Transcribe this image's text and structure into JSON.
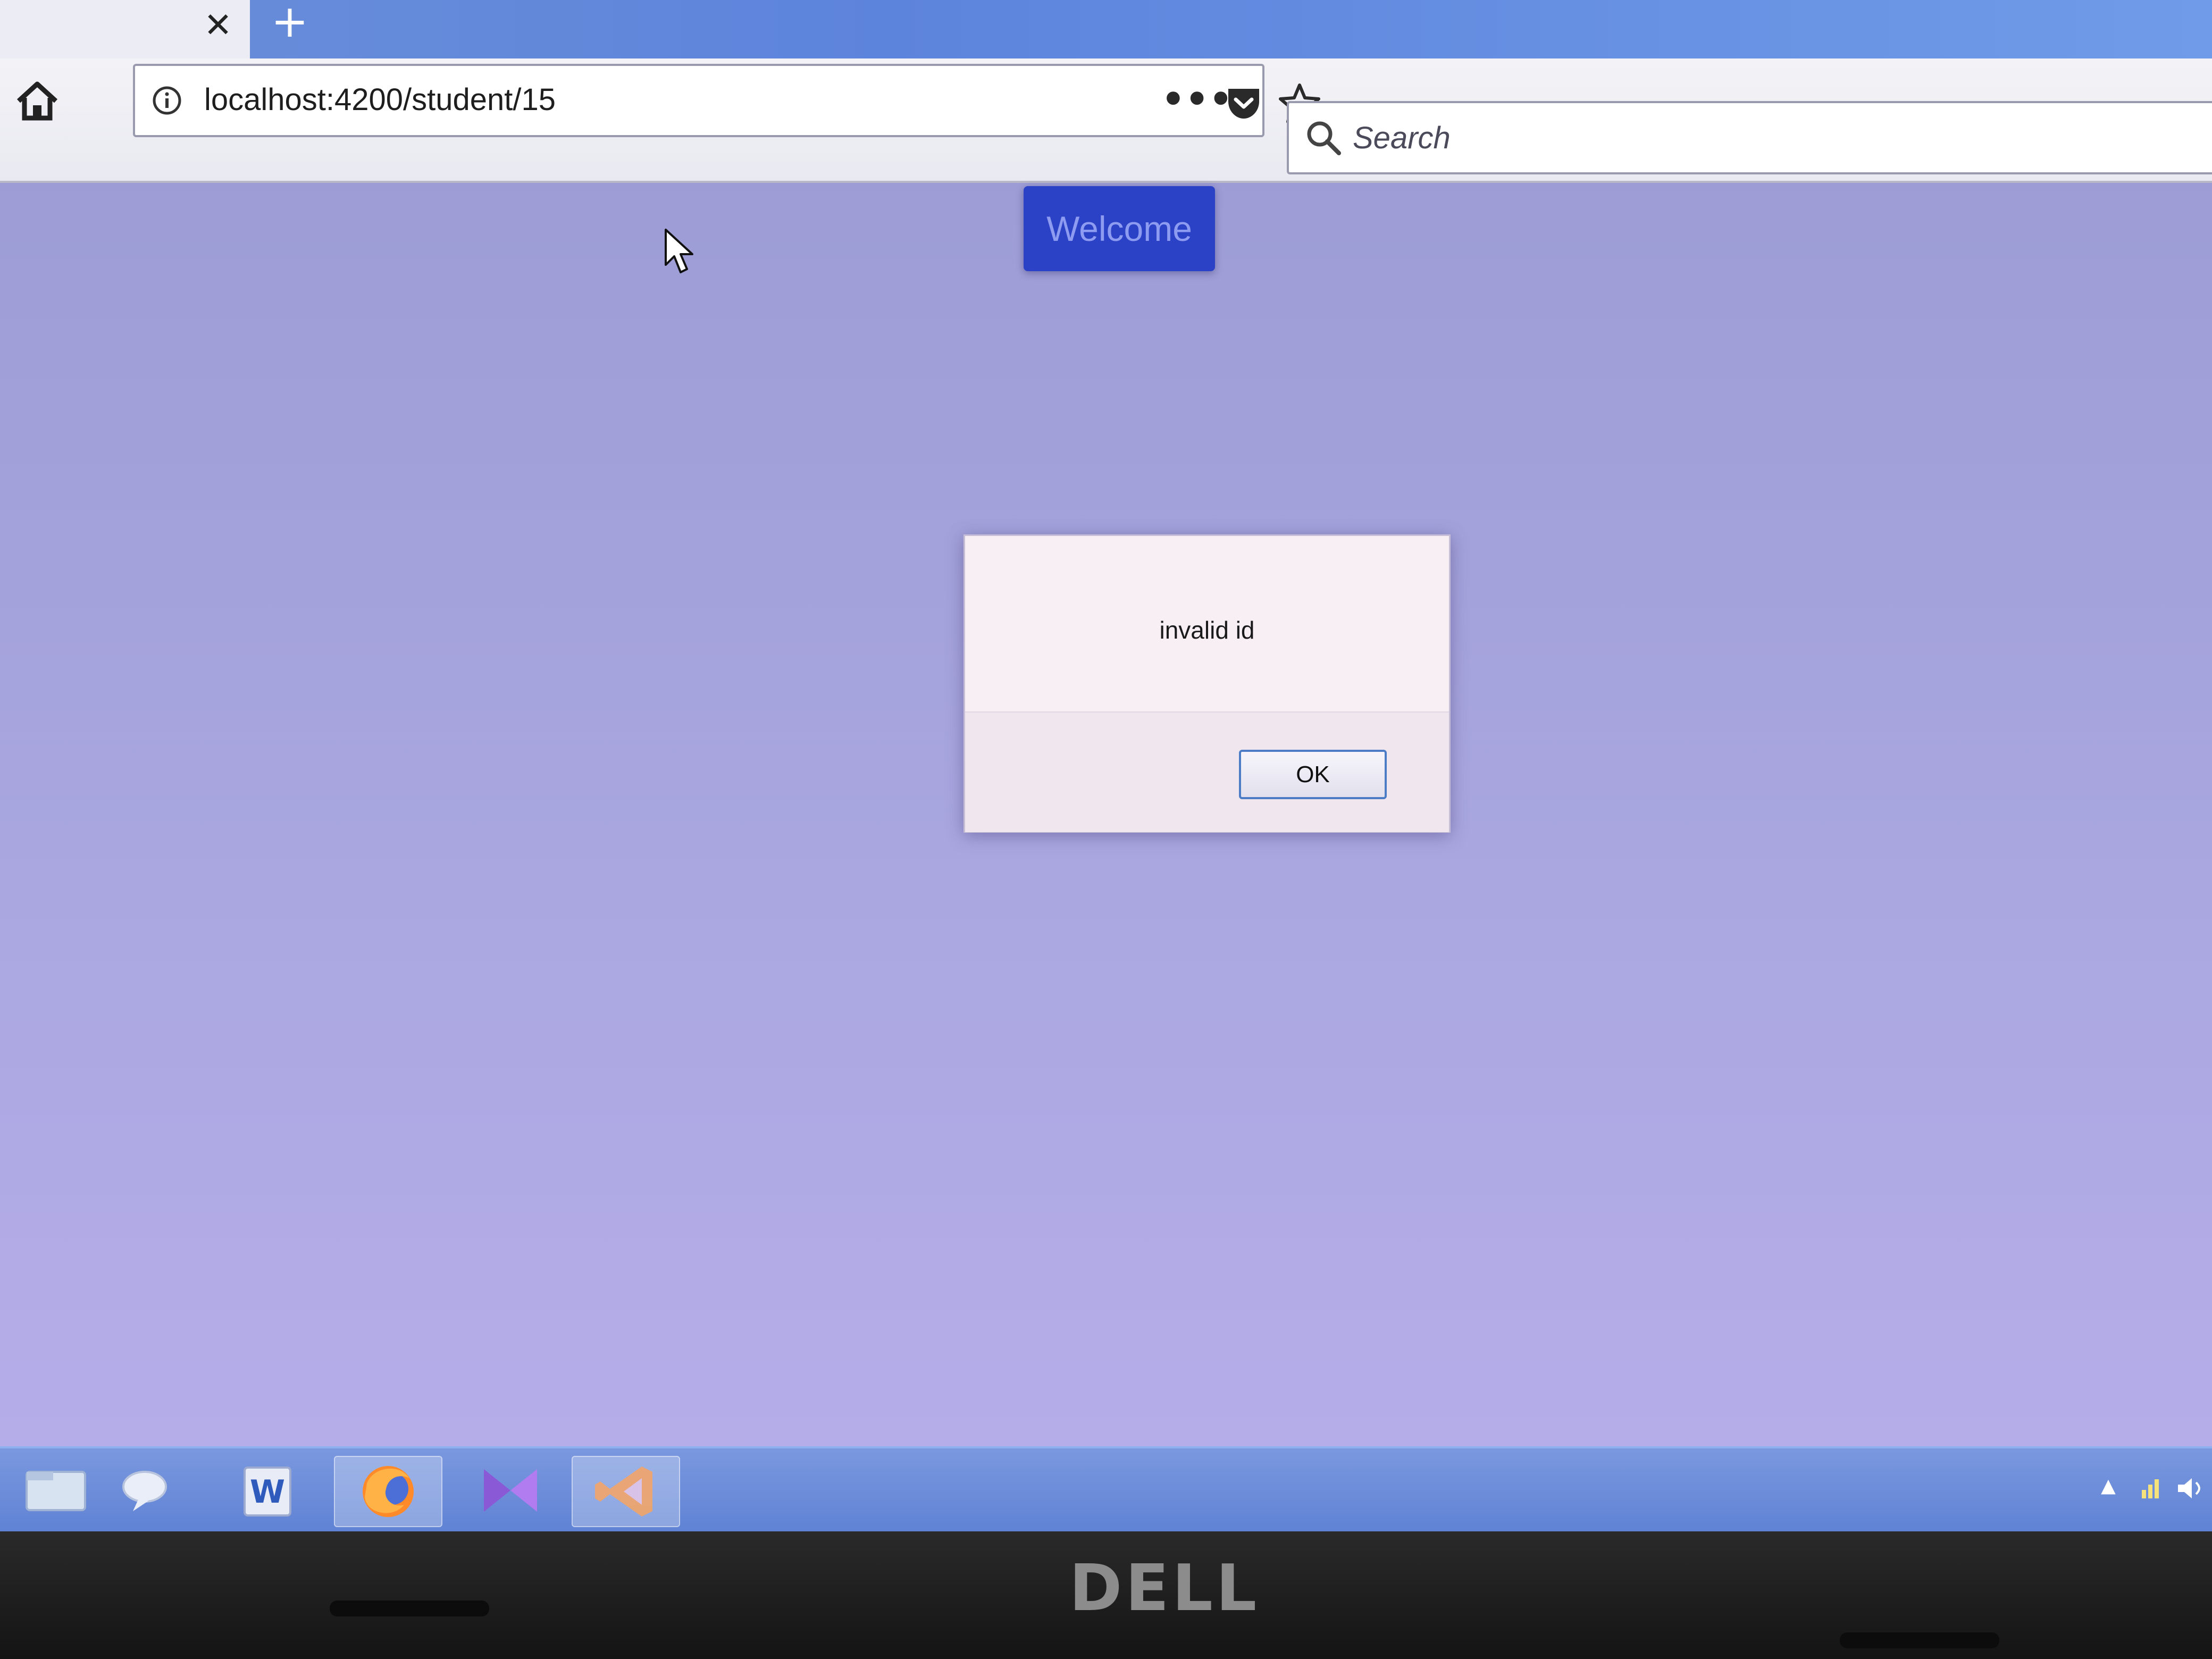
{
  "browser": {
    "tab": {
      "close_icon": "close-icon",
      "new_tab_icon": "plus-icon"
    },
    "nav": {
      "home_icon": "home-icon",
      "url": "localhost:4200/student/15",
      "info_icon": "info-icon",
      "page_actions_label": "•••",
      "pocket_icon": "pocket-icon",
      "bookmark_icon": "star-icon"
    },
    "search": {
      "placeholder": "Search",
      "icon": "search-icon"
    }
  },
  "page": {
    "welcome_button": "Welcome"
  },
  "alert": {
    "message": "invalid id",
    "ok_label": "OK"
  },
  "taskbar": {
    "apps": [
      {
        "name": "file-explorer-icon"
      },
      {
        "name": "chat-app-icon"
      },
      {
        "name": "word-icon",
        "label": "W"
      },
      {
        "name": "firefox-icon",
        "active": true
      },
      {
        "name": "visual-studio-icon"
      },
      {
        "name": "vscode-icon",
        "active": true
      }
    ],
    "tray": [
      "chevron-up-icon",
      "network-icon",
      "volume-icon"
    ]
  },
  "device": {
    "brand": "DELL"
  },
  "colors": {
    "page_background": "#a9a6df",
    "welcome_button": "#2b41c6",
    "dialog_background": "#f2eaf0",
    "ok_button_border": "#4d7cc7",
    "taskbar": "#6a8bd8"
  }
}
